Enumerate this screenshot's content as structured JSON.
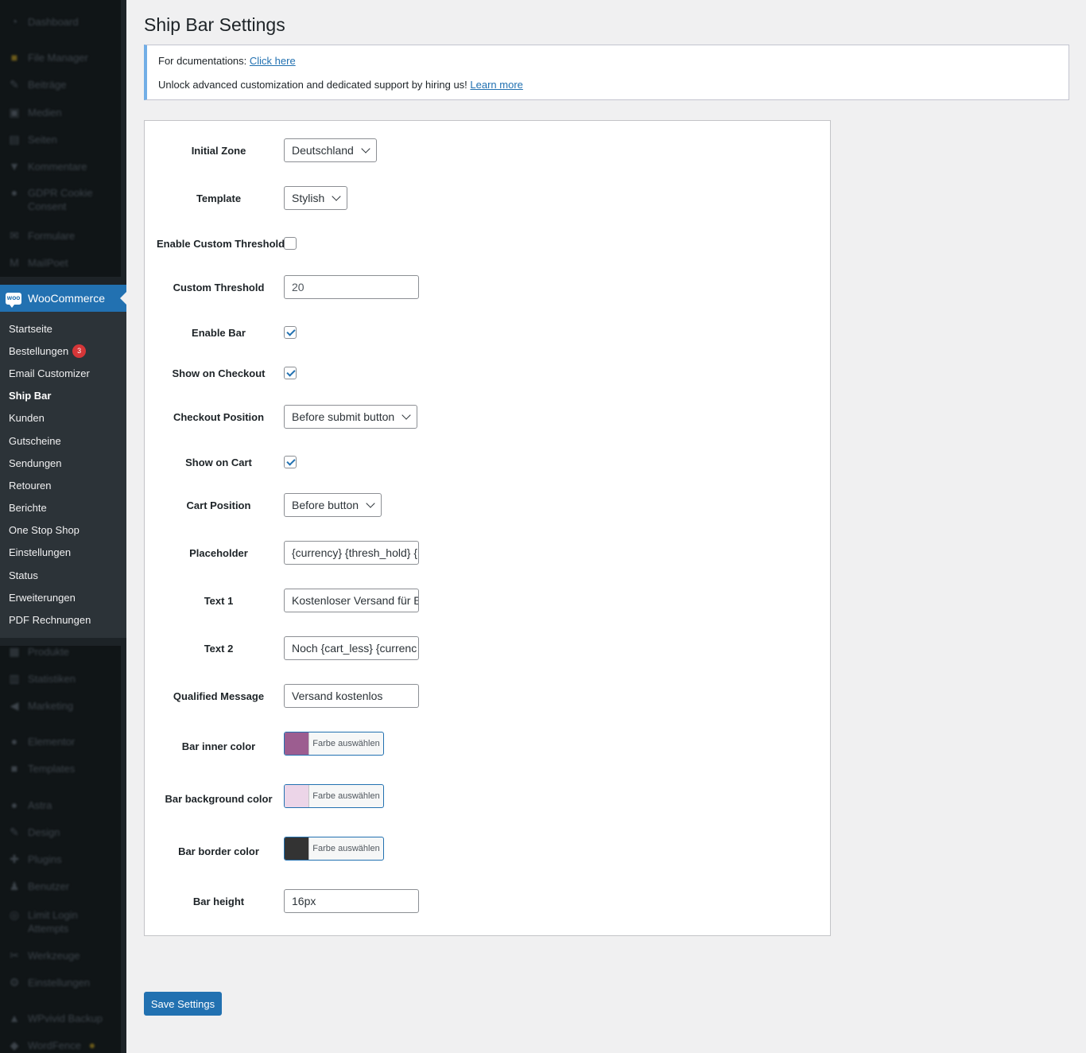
{
  "sidebar": {
    "top_items": [
      {
        "label": "Dashboard",
        "icon": "gauge-icon"
      },
      {
        "label": "File Manager",
        "icon": "folder-icon"
      },
      {
        "label": "Beiträge",
        "icon": "pin-icon"
      },
      {
        "label": "Medien",
        "icon": "media-icon"
      },
      {
        "label": "Seiten",
        "icon": "page-icon"
      },
      {
        "label": "Kommentare",
        "icon": "comment-icon"
      },
      {
        "label": "GDPR Cookie Consent",
        "icon": "cookie-icon"
      },
      {
        "label": "Formulare",
        "icon": "mail-icon"
      },
      {
        "label": "MailPoet",
        "icon": "mailpoet-icon"
      }
    ],
    "woocommerce": {
      "label": "WooCommerce",
      "logo_text": "WOO"
    },
    "submenu": [
      {
        "label": "Startseite"
      },
      {
        "label": "Bestellungen",
        "badge": "3"
      },
      {
        "label": "Email Customizer"
      },
      {
        "label": "Ship Bar",
        "current": true
      },
      {
        "label": "Kunden"
      },
      {
        "label": "Gutscheine"
      },
      {
        "label": "Sendungen"
      },
      {
        "label": "Retouren"
      },
      {
        "label": "Berichte"
      },
      {
        "label": "One Stop Shop"
      },
      {
        "label": "Einstellungen"
      },
      {
        "label": "Status"
      },
      {
        "label": "Erweiterungen"
      },
      {
        "label": "PDF Rechnungen"
      }
    ],
    "bottom_items": [
      {
        "label": "Produkte",
        "icon": "box-icon"
      },
      {
        "label": "Statistiken",
        "icon": "chart-icon"
      },
      {
        "label": "Marketing",
        "icon": "megaphone-icon"
      },
      {
        "label": "Elementor",
        "icon": "elementor-icon"
      },
      {
        "label": "Templates",
        "icon": "folder-icon"
      },
      {
        "label": "Astra",
        "icon": "astra-icon"
      },
      {
        "label": "Design",
        "icon": "brush-icon"
      },
      {
        "label": "Plugins",
        "icon": "plugin-icon"
      },
      {
        "label": "Benutzer",
        "icon": "user-icon"
      },
      {
        "label": "Limit Login Attempts",
        "icon": "lock-icon"
      },
      {
        "label": "Werkzeuge",
        "icon": "wrench-icon"
      },
      {
        "label": "Einstellungen",
        "icon": "settings-icon"
      },
      {
        "label": "WPvivid Backup",
        "icon": "backup-icon"
      },
      {
        "label": "WordFence",
        "icon": "shield-icon"
      }
    ]
  },
  "page": {
    "title": "Ship Bar Settings"
  },
  "notice": {
    "doc_text": "For dcumentations: ",
    "doc_link": "Click here",
    "hire_text": "Unlock advanced customization and dedicated support by hiring us! ",
    "hire_link": "Learn more"
  },
  "settings": {
    "initial_zone": {
      "label": "Initial Zone",
      "value": "Deutschland"
    },
    "template": {
      "label": "Template",
      "value": "Stylish"
    },
    "enable_custom_threshold": {
      "label": "Enable Custom Threshold",
      "checked": false
    },
    "custom_threshold": {
      "label": "Custom Threshold",
      "value": "20"
    },
    "enable_bar": {
      "label": "Enable Bar",
      "checked": true
    },
    "show_on_checkout": {
      "label": "Show on Checkout",
      "checked": true
    },
    "checkout_position": {
      "label": "Checkout Position",
      "value": "Before submit button"
    },
    "show_on_cart": {
      "label": "Show on Cart",
      "checked": true
    },
    "cart_position": {
      "label": "Cart Position",
      "value": "Before button"
    },
    "placeholder": {
      "label": "Placeholder",
      "value": "{currency} {thresh_hold} {"
    },
    "text1": {
      "label": "Text 1",
      "value": "Kostenloser Versand für E"
    },
    "text2": {
      "label": "Text 2",
      "value": "Noch {cart_less} {currenc"
    },
    "qualified_message": {
      "label": "Qualified Message",
      "value": "Versand kostenlos"
    },
    "bar_inner_color": {
      "label": "Bar inner color",
      "color": "#9c5d90",
      "button_text": "Farbe auswählen"
    },
    "bar_background_color": {
      "label": "Bar background color",
      "color": "#ecd5e8",
      "button_text": "Farbe auswählen"
    },
    "bar_border_color": {
      "label": "Bar border color",
      "color": "#333333",
      "button_text": "Farbe auswählen"
    },
    "bar_height": {
      "label": "Bar height",
      "value": "16px"
    }
  },
  "save_button": {
    "label": "Save Settings"
  },
  "colors": {
    "accent": "#2271b1",
    "sidebar_bg": "#1d2327",
    "submenu_bg": "#2c3338",
    "badge": "#d63638",
    "notice_border": "#72aee6"
  }
}
